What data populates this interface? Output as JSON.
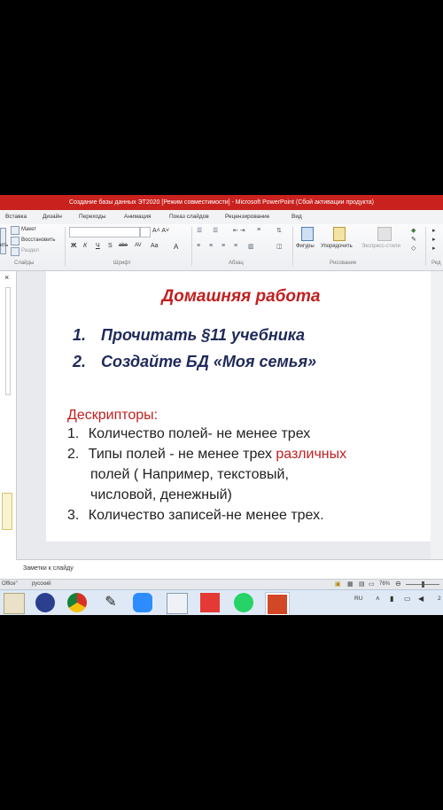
{
  "window": {
    "title": "Создание базы данных ЭТ2020 [Режим совместимости] - Microsoft PowerPoint (Сбой активации продукта)"
  },
  "ribbon": {
    "tabs": [
      "Вставка",
      "Дизайн",
      "Переходы",
      "Анимация",
      "Показ слайдов",
      "Рецензирование",
      "Вид"
    ],
    "slides_group": {
      "layout": "Макет",
      "reset": "Восстановить",
      "section": "Раздел",
      "paste_partial": "ить",
      "name": "Слайды"
    },
    "font_group": {
      "name": "Шрифт",
      "font_size_value": ""
    },
    "paragraph_group": {
      "name": "Абзац"
    },
    "drawing_group": {
      "shapes": "Фигуры",
      "arrange": "Упорядочить",
      "quick_styles": "Экспресс-стили",
      "name": "Рисование"
    },
    "editing_group": {
      "name_partial": "Ред"
    }
  },
  "slide": {
    "title": "Домашняя работа",
    "tasks": [
      {
        "num": "1.",
        "text": "Прочитать §11 учебника"
      },
      {
        "num": "2.",
        "text": "Создайте БД «Моя семья»"
      }
    ],
    "descriptors_heading": "Дескрипторы:",
    "item1": {
      "num": "1.",
      "text": "Количество полей- не менее трех"
    },
    "item2": {
      "num": "2.",
      "text_a": "Типы полей - не менее трех ",
      "highlight": "различных",
      "line2": "полей ( Например, текстовый,",
      "line3": "числовой, денежный)"
    },
    "item3": {
      "num": "3.",
      "text": "Количество записей-не менее трех."
    }
  },
  "notes": {
    "placeholder": "Заметки к слайду"
  },
  "status": {
    "theme": "Office\"",
    "language": "русский",
    "zoom": "76%"
  },
  "tray": {
    "lang": "RU",
    "clock_partial": "2"
  },
  "colors": {
    "titlebar": "#c9211e",
    "title_text": "#c21f1f",
    "task_text": "#1f2a5a"
  }
}
